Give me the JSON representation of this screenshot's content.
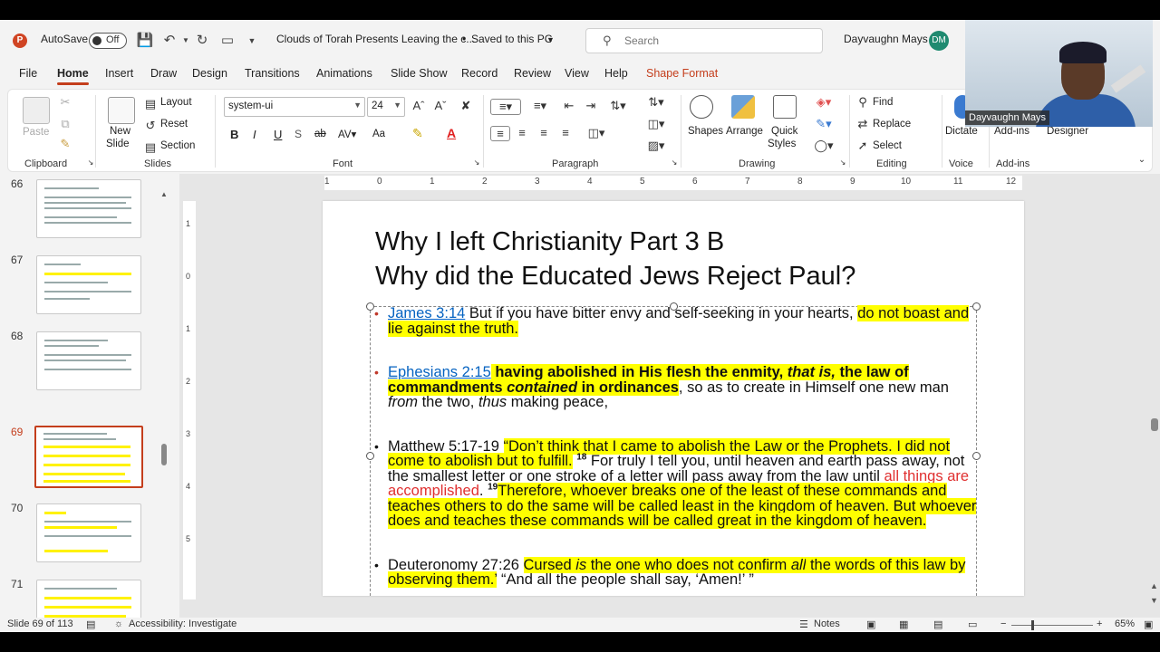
{
  "titlebar": {
    "autosave_label": "AutoSave",
    "autosave_state": "Off",
    "doc_title": "Clouds of Torah Presents Leaving the c...",
    "save_status": "Saved to this PC",
    "search_placeholder": "Search",
    "user_name": "Dayvaughn Mays",
    "user_initials": "DM"
  },
  "menu": {
    "tabs": [
      "File",
      "Home",
      "Insert",
      "Draw",
      "Design",
      "Transitions",
      "Animations",
      "Slide Show",
      "Record",
      "Review",
      "View",
      "Help",
      "Shape Format"
    ],
    "active": "Home"
  },
  "ribbon": {
    "clipboard": {
      "label": "Clipboard",
      "paste": "Paste"
    },
    "slides": {
      "label": "Slides",
      "new_slide": "New",
      "new_slide2": "Slide",
      "layout": "Layout",
      "reset": "Reset",
      "section": "Section"
    },
    "font": {
      "label": "Font",
      "family": "system-ui",
      "size": "24",
      "bold": "B",
      "italic": "I",
      "underline": "U",
      "strike": "ab",
      "aa": "Aa"
    },
    "paragraph": {
      "label": "Paragraph"
    },
    "drawing": {
      "label": "Drawing",
      "shapes": "Shapes",
      "arrange": "Arrange",
      "quick_styles": "Quick",
      "quick_styles2": "Styles"
    },
    "editing": {
      "label": "Editing",
      "find": "Find",
      "replace": "Replace",
      "select": "Select"
    },
    "voice": {
      "label": "Voice",
      "dictate": "Dictate"
    },
    "addins": {
      "label": "Add-ins",
      "addins_btn": "Add-ins",
      "designer": "Designer"
    }
  },
  "webcam": {
    "name": "Dayvaughn Mays"
  },
  "thumbnails": [
    {
      "num": "66",
      "active": false
    },
    {
      "num": "67",
      "active": false
    },
    {
      "num": "68",
      "active": false
    },
    {
      "num": "69",
      "active": true
    },
    {
      "num": "70",
      "active": false
    },
    {
      "num": "71",
      "active": false
    }
  ],
  "ruler": {
    "h_ticks": [
      "1",
      "0",
      "1",
      "2",
      "3",
      "4",
      "5",
      "6",
      "7",
      "8",
      "9",
      "10",
      "11",
      "12"
    ],
    "v_ticks": [
      "1",
      "0",
      "1",
      "2",
      "3",
      "4",
      "5"
    ]
  },
  "slide": {
    "title_line1": "Why I left Christianity Part 3 B",
    "title_line2": "Why did the Educated Jews Reject Paul?",
    "b1_ref": "James 3:14",
    "b1_text": " But if you have bitter envy and self-seeking in your hearts, ",
    "b1_hl": "do not boast and lie against the truth.",
    "b2_ref": "Ephesians 2:15",
    "b2_a": " having abolished in His flesh the enmity, ",
    "b2_b": "that is,",
    "b2_c": " the law of commandments ",
    "b2_d": "contained",
    "b2_e": " in ordinances",
    "b2_f": ", so as to create in Himself one new man ",
    "b2_g": "from",
    "b2_h": " the two, ",
    "b2_i": "thus",
    "b2_j": " making peace,",
    "b3_ref": "Matthew 5:17-19 ",
    "b3_a": "“Don’t think that I came to abolish the Law or the Prophets. I did not come to abolish but to fulfill.",
    "b3_sup1": "18",
    "b3_b": " For truly I tell you, until heaven and earth pass away, not the smallest letter or one stroke of a letter will pass away from the law until ",
    "b3_c": "all things are accomplished",
    "b3_d": ".",
    "b3_sup2": "19",
    "b3_e": "Therefore, whoever breaks one of the least of these commands and teaches others to do the same will be called least in the kingdom of heaven. But whoever does and teaches these commands will be called great in the kingdom of heaven.",
    "b4_ref": "Deuteronomy 27:26 ",
    "b4_a": "Cursed ",
    "b4_b": "is",
    "b4_c": " the one who does not confirm ",
    "b4_d": "all",
    "b4_e": " the words of this law by observing them.’",
    "b4_f": " “And all the people shall say, ‘Amen!’ ”"
  },
  "status": {
    "slide_info": "Slide 69 of 113",
    "accessibility": "Accessibility: Investigate",
    "notes": "Notes",
    "zoom": "65%",
    "zoom_value": 0.65
  },
  "colors": {
    "accent": "#c43e1c",
    "highlight": "#ffff00",
    "link": "#0563c1"
  }
}
